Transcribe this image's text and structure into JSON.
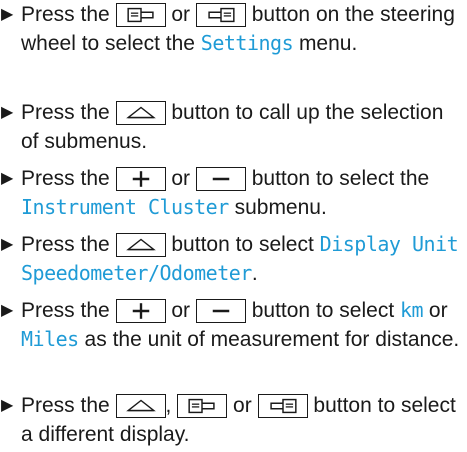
{
  "steps": [
    {
      "parts": [
        {
          "t": "text",
          "v": "Press the "
        },
        {
          "t": "button",
          "icon": "page-back-icon"
        },
        {
          "t": "text",
          "v": " or "
        },
        {
          "t": "button",
          "icon": "page-forward-icon"
        },
        {
          "t": "text",
          "v": " button on the steering wheel to select the "
        },
        {
          "t": "hl",
          "v": "Settings"
        },
        {
          "t": "text",
          "v": " menu."
        }
      ]
    },
    {
      "parts": [
        {
          "t": "text",
          "v": "Press the "
        },
        {
          "t": "button",
          "icon": "up-arrow-icon"
        },
        {
          "t": "text",
          "v": " button to call up the selection of submenus."
        }
      ]
    },
    {
      "parts": [
        {
          "t": "text",
          "v": "Press the "
        },
        {
          "t": "button",
          "icon": "plus-icon"
        },
        {
          "t": "text",
          "v": " or "
        },
        {
          "t": "button",
          "icon": "minus-icon"
        },
        {
          "t": "text",
          "v": " button to select the "
        },
        {
          "t": "hl",
          "v": "Instrument Cluster"
        },
        {
          "t": "text",
          "v": " submenu."
        }
      ]
    },
    {
      "parts": [
        {
          "t": "text",
          "v": "Press the "
        },
        {
          "t": "button",
          "icon": "up-arrow-icon"
        },
        {
          "t": "text",
          "v": " button to select "
        },
        {
          "t": "hl",
          "v": "Display Unit Speedometer/Odometer"
        },
        {
          "t": "text",
          "v": "."
        }
      ]
    },
    {
      "parts": [
        {
          "t": "text",
          "v": "Press the "
        },
        {
          "t": "button",
          "icon": "plus-icon"
        },
        {
          "t": "text",
          "v": " or "
        },
        {
          "t": "button",
          "icon": "minus-icon"
        },
        {
          "t": "text",
          "v": " button to select "
        },
        {
          "t": "hl",
          "v": "km"
        },
        {
          "t": "text",
          "v": " or "
        },
        {
          "t": "hl",
          "v": "Miles"
        },
        {
          "t": "text",
          "v": " as the unit of measurement for distance."
        }
      ]
    },
    {
      "parts": [
        {
          "t": "text",
          "v": "Press the "
        },
        {
          "t": "button",
          "icon": "up-arrow-icon"
        },
        {
          "t": "text",
          "v": ", "
        },
        {
          "t": "button",
          "icon": "page-back-icon"
        },
        {
          "t": "text",
          "v": " or "
        },
        {
          "t": "button",
          "icon": "page-forward-icon"
        },
        {
          "t": "text",
          "v": " button to select a different display."
        }
      ]
    }
  ],
  "colors": {
    "text": "#1a1a1a",
    "highlight": "#1f9bd6",
    "background": "#ffffff"
  }
}
